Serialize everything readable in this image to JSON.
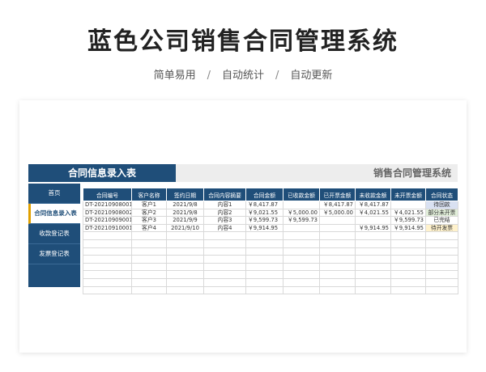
{
  "header": {
    "title": "蓝色公司销售合同管理系统",
    "features": [
      "简单易用",
      "自动统计",
      "自动更新"
    ],
    "separator": "/"
  },
  "sheet": {
    "section_title": "合同信息录入表",
    "system_title": "销售合同管理系统",
    "nav": [
      {
        "label": "首页"
      },
      {
        "label": "合同信息录入表"
      },
      {
        "label": "收款登记表"
      },
      {
        "label": "发票登记表"
      }
    ],
    "active_nav_index": 1,
    "columns": [
      "合同编号",
      "客户名称",
      "签约日期",
      "合同内容摘要",
      "合同金额",
      "已收款金额",
      "已开票金额",
      "未收款金额",
      "未开票金额",
      "合同状态"
    ],
    "rows": [
      [
        "DT-20210908001",
        "客户1",
        "2021/9/8",
        "内容1",
        "￥8,417.87",
        "",
        "￥8,417.87",
        "￥8,417.87",
        "",
        "待回款"
      ],
      [
        "DT-20210908002",
        "客户2",
        "2021/9/8",
        "内容2",
        "￥9,021.55",
        "￥5,000.00",
        "￥5,000.00",
        "￥4,021.55",
        "￥4,021.55",
        "部分未开票"
      ],
      [
        "DT-20210909001",
        "客户3",
        "2021/9/9",
        "内容3",
        "￥9,599.73",
        "￥9,599.73",
        "",
        "",
        "￥9,599.73",
        "已完结"
      ],
      [
        "DT-20210910001",
        "客户4",
        "2021/9/10",
        "内容4",
        "￥9,914.95",
        "",
        "",
        "￥9,914.95",
        "￥9,914.95",
        "待开发票"
      ]
    ],
    "empty_rows": 8,
    "status_colors": {
      "待回款": "#d9e1f2",
      "部分未开票": "#e2efda",
      "已完结": "#ffffff",
      "待开发票": "#fff2cc"
    },
    "accent_color": "#1f4e79"
  }
}
